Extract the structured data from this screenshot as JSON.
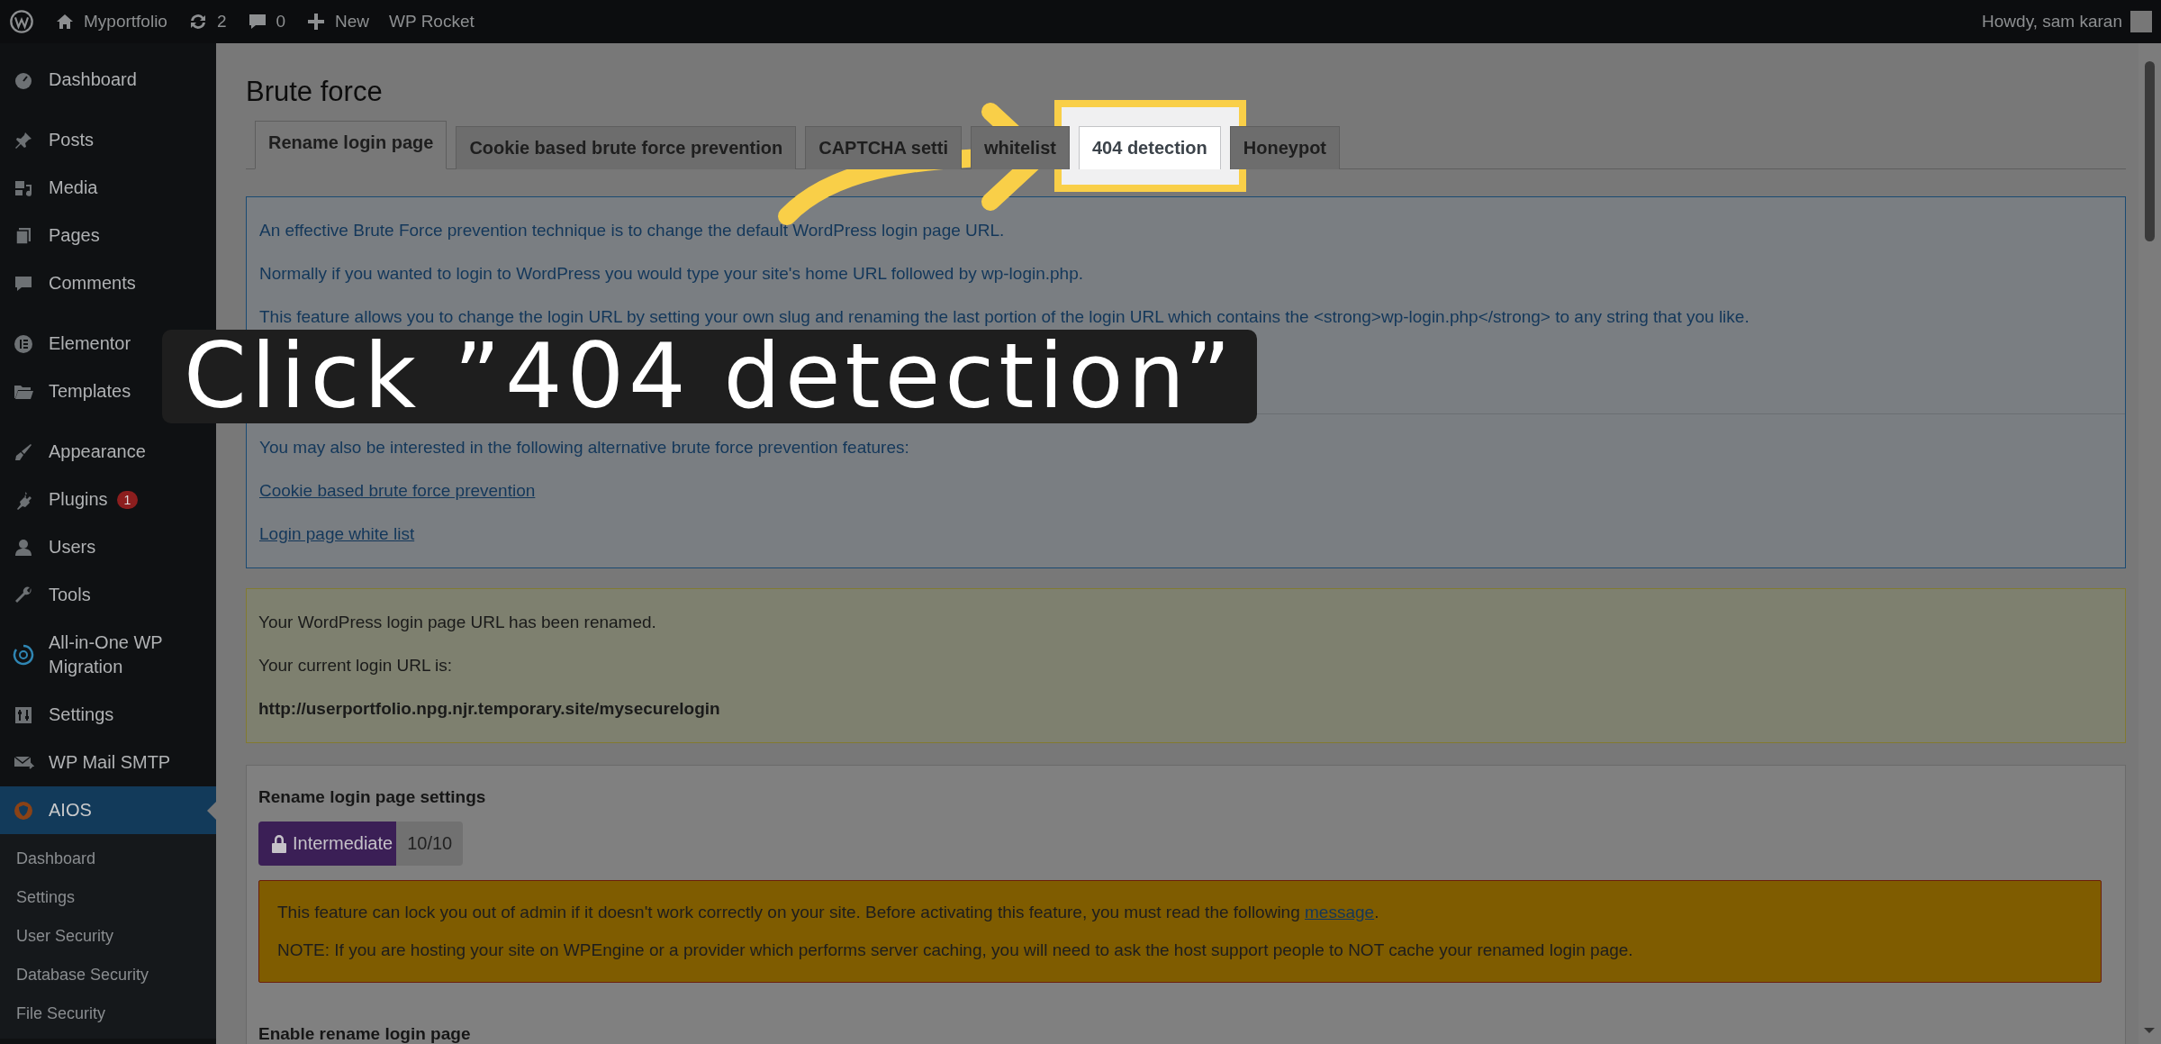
{
  "admin_bar": {
    "items": [
      {
        "kind": "logo"
      },
      {
        "kind": "home",
        "label": "Myportfolio"
      },
      {
        "kind": "updates",
        "label": "2"
      },
      {
        "kind": "comments",
        "label": "0"
      },
      {
        "kind": "new",
        "label": "New"
      },
      {
        "kind": "plain",
        "label": "WP Rocket"
      }
    ],
    "greeting": "Howdy, sam karan"
  },
  "sidebar": {
    "groups": [
      [
        {
          "kind": "dashboard",
          "label": "Dashboard",
          "selected": false
        }
      ],
      [
        {
          "kind": "pin",
          "label": "Posts",
          "selected": false
        },
        {
          "kind": "media",
          "label": "Media",
          "selected": false
        },
        {
          "kind": "pages",
          "label": "Pages",
          "selected": false
        },
        {
          "kind": "comments",
          "label": "Comments",
          "selected": false
        }
      ],
      [
        {
          "kind": "elementor",
          "label": "Elementor",
          "selected": false
        },
        {
          "kind": "folder",
          "label": "Templates",
          "selected": false
        }
      ],
      [
        {
          "kind": "brush",
          "label": "Appearance",
          "selected": false
        },
        {
          "kind": "plug",
          "label": "Plugins",
          "selected": false,
          "badge": "1"
        },
        {
          "kind": "user",
          "label": "Users",
          "selected": false
        },
        {
          "kind": "wrench",
          "label": "Tools",
          "selected": false
        },
        {
          "kind": "migration",
          "label": "All-in-One WP Migration",
          "selected": false
        },
        {
          "kind": "sliders",
          "label": "Settings",
          "selected": false
        },
        {
          "kind": "mail",
          "label": "WP Mail SMTP",
          "selected": false
        },
        {
          "kind": "shield",
          "label": "AIOS",
          "selected": true
        }
      ]
    ],
    "submenu": [
      {
        "label": "Dashboard"
      },
      {
        "label": "Settings"
      },
      {
        "label": "User Security"
      },
      {
        "label": "Database Security"
      },
      {
        "label": "File Security"
      }
    ]
  },
  "page_title": "Brute force",
  "tabs": [
    {
      "label": "Rename login page",
      "selected": true,
      "highlighted": false
    },
    {
      "label": "Cookie based brute force prevention",
      "selected": false,
      "highlighted": false
    },
    {
      "label": "CAPTCHA setti",
      "selected": false,
      "highlighted": false
    },
    {
      "label": "whitelist",
      "selected": false,
      "highlighted": false
    },
    {
      "label": "404 detection",
      "selected": false,
      "highlighted": true
    },
    {
      "label": "Honeypot",
      "selected": false,
      "highlighted": false
    }
  ],
  "info_panel": {
    "paragraphs": [
      "An effective Brute Force prevention technique is to change the default WordPress login page URL.",
      "Normally if you wanted to login to WordPress you would type your site's home URL followed by wp-login.php.",
      "This feature allows you to change the login URL by setting your own slug and renaming the last portion of the login URL which contains the <strong>wp-login.php</strong> to any string that you like."
    ],
    "alternatives_intro": "You may also be interested in the following alternative brute force prevention features:",
    "links": [
      "Cookie based brute force prevention",
      "Login page white list"
    ]
  },
  "notice": {
    "lines": [
      {
        "text": "Your WordPress login page URL has been renamed.",
        "strong": false
      },
      {
        "text": "Your current login URL is:",
        "strong": false
      },
      {
        "text": "http://userportfolio.npg.njr.temporary.site/mysecurelogin",
        "strong": true
      }
    ]
  },
  "settings": {
    "title": "Rename login page settings",
    "level_badge": {
      "label": "Intermediate",
      "score": "10/10"
    },
    "warning": {
      "before": "This feature can lock you out of admin if it doesn't work correctly on your site. Before activating this feature, you must read the following ",
      "link": "message",
      "after": ".",
      "note": "NOTE: If you are hosting your site on WPEngine or a provider which performs server caching, you will need to ask the host support people to NOT cache your renamed login page."
    },
    "field_label": "Enable rename login page"
  },
  "tutorial": {
    "caption": "Click ”404 detection”"
  }
}
